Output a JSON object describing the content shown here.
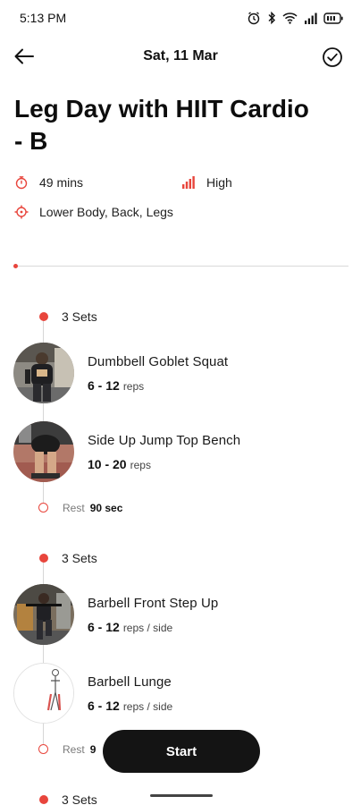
{
  "status_bar": {
    "time": "5:13 PM"
  },
  "header": {
    "date": "Sat, 11 Mar"
  },
  "workout": {
    "title": "Leg Day with HIIT Cardio - B",
    "duration": "49 mins",
    "intensity": "High",
    "focus": "Lower Body, Back, Legs"
  },
  "accent_color": "#e8453c",
  "blocks": [
    {
      "sets_label": "3 Sets",
      "exercises": [
        {
          "name": "Dumbbell Goblet Squat",
          "reps": "6 - 12",
          "unit": "reps"
        },
        {
          "name": "Side Up Jump Top Bench",
          "reps": "10 - 20",
          "unit": "reps"
        }
      ],
      "rest": {
        "label": "Rest",
        "value": "90 sec"
      }
    },
    {
      "sets_label": "3 Sets",
      "exercises": [
        {
          "name": "Barbell Front Step Up",
          "reps": "6 - 12",
          "unit": "reps / side"
        },
        {
          "name": "Barbell Lunge",
          "reps": "6 - 12",
          "unit": "reps / side"
        }
      ],
      "rest": {
        "label": "Rest",
        "value": "9"
      }
    },
    {
      "sets_label": "3 Sets"
    }
  ],
  "start_button": {
    "label": "Start"
  }
}
